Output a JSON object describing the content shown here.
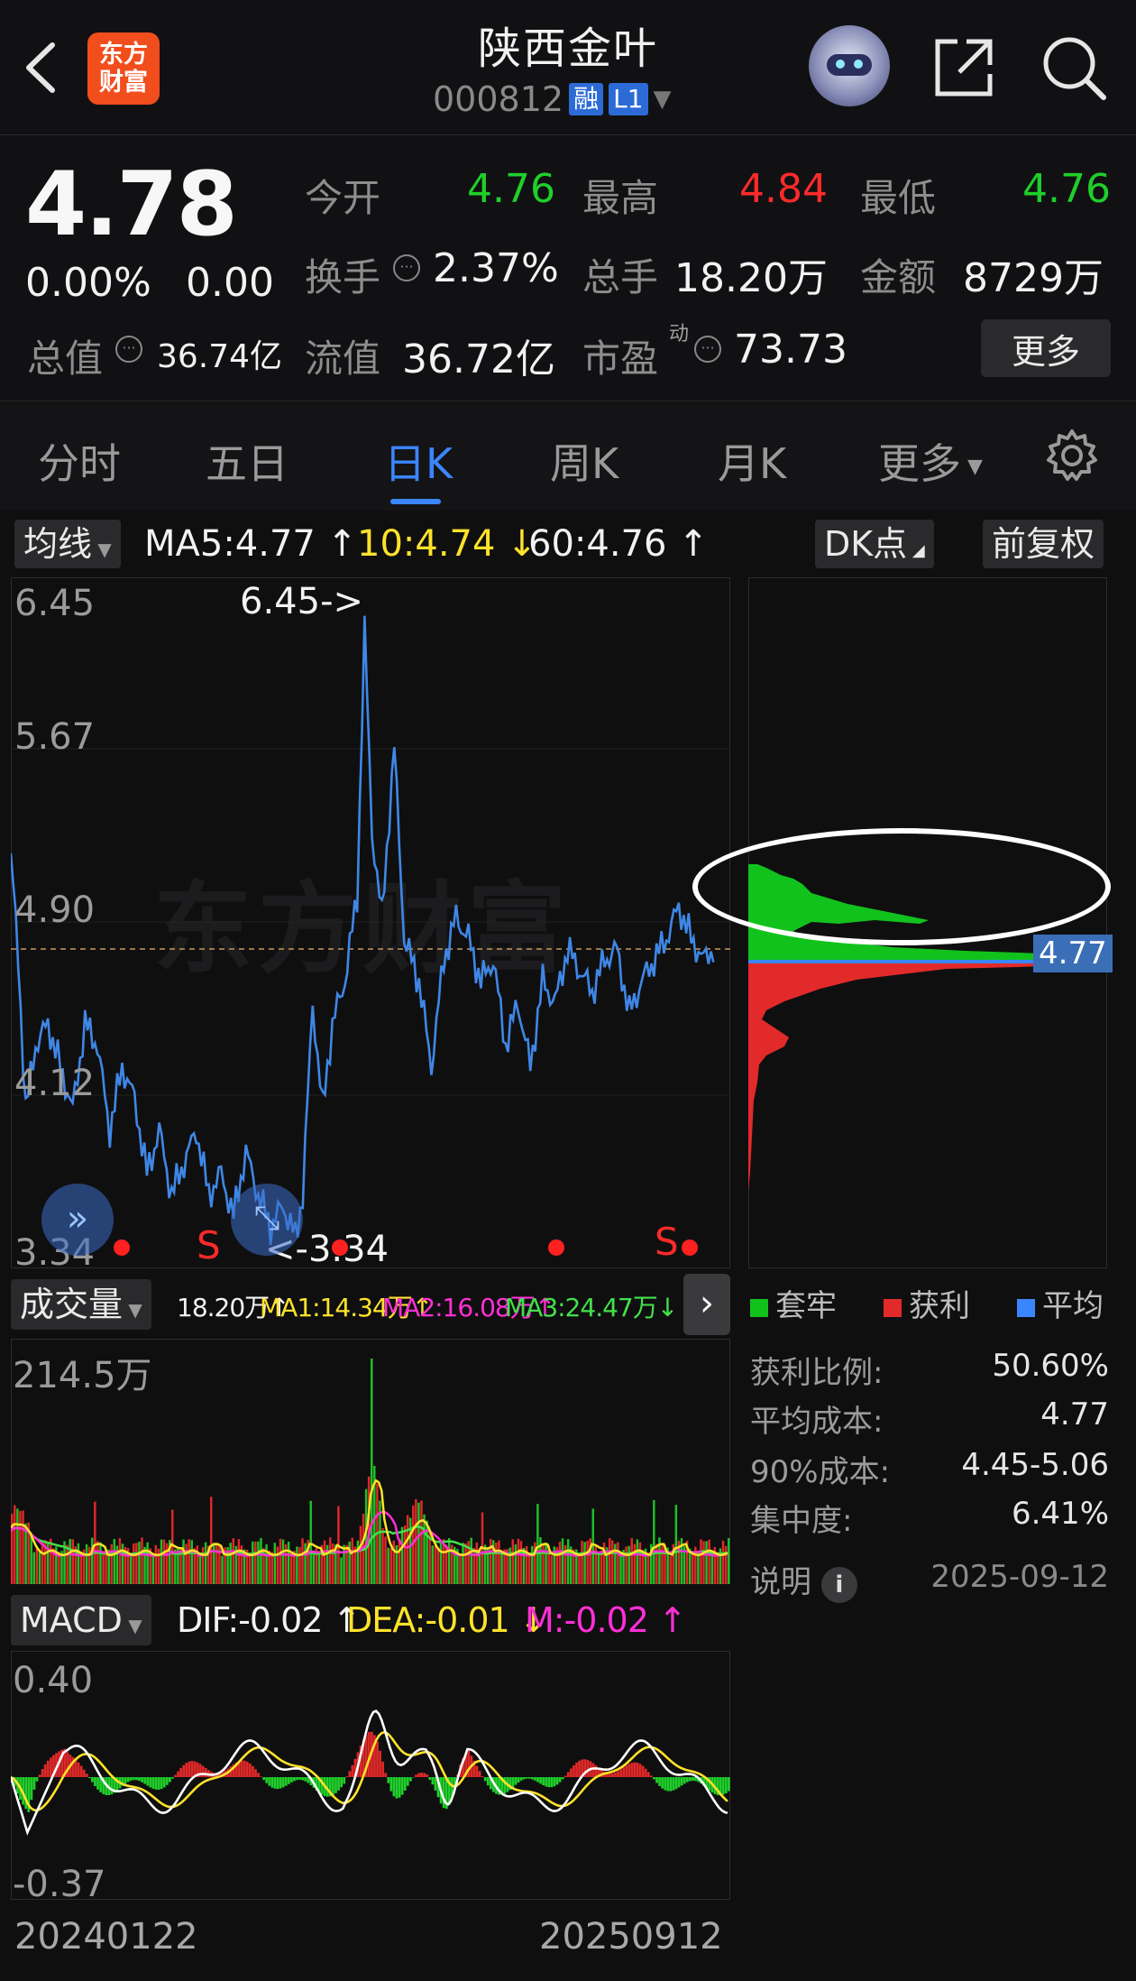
{
  "header": {
    "logo_line1": "东方",
    "logo_line2": "财富",
    "title": "陕西金叶",
    "code": "000812",
    "tag_margin": "融",
    "tag_level": "L1"
  },
  "quote": {
    "price": "4.78",
    "change_pct": "0.00%",
    "change": "0.00",
    "open_label": "今开",
    "open": "4.76",
    "high_label": "最高",
    "high": "4.84",
    "low_label": "最低",
    "low": "4.76",
    "turnover_label": "换手",
    "turnover": "2.37%",
    "volume_label": "总手",
    "volume": "18.20万",
    "amount_label": "金额",
    "amount": "8729万",
    "mktcap_label": "总值",
    "mktcap": "36.74亿",
    "float_label": "流值",
    "float": "36.72亿",
    "pe_label": "市盈",
    "pe_sup": "动",
    "pe": "73.73",
    "more_label": "更多"
  },
  "tabs": [
    "分时",
    "五日",
    "日K",
    "周K",
    "月K",
    "更多"
  ],
  "active_tab": "日K",
  "indicator": {
    "ma_chip": "均线",
    "ma5": "MA5:4.77 ↑",
    "ma10": "10:4.74 ↓",
    "ma60": "60:4.76 ↑",
    "dk_chip": "DK点",
    "adjust_chip": "前复权"
  },
  "kline": {
    "y_labels": [
      "6.45",
      "5.67",
      "4.90",
      "4.12",
      "3.34"
    ],
    "max_marker": "6.45->",
    "min_marker": "<-3.34",
    "sell_marker": "S",
    "current_price_tag": "4.77",
    "watermark": "东方财富"
  },
  "volume": {
    "chip": "成交量",
    "vol": "18.20万↑",
    "ma1": "MA1:14.34万↑",
    "ma2": "MA2:16.08万↑",
    "ma3": "MA3:24.47万↓",
    "y_max": "214.5万"
  },
  "macd": {
    "chip": "MACD",
    "dif": "DIF:-0.02 ↑",
    "dea": "DEA:-0.01 ↓",
    "m": "M:-0.02 ↑",
    "y_top": "0.40",
    "y_bottom": "-0.37",
    "date_start": "20240122",
    "date_end": "20250912"
  },
  "chip_dist": {
    "legend_trapped": "套牢",
    "legend_profit": "获利",
    "legend_avg": "平均",
    "profit_ratio_label": "获利比例:",
    "profit_ratio": "50.60%",
    "avg_cost_label": "平均成本:",
    "avg_cost": "4.77",
    "cost90_label": "90%成本:",
    "cost90": "4.45-5.06",
    "concentration_label": "集中度:",
    "concentration": "6.41%",
    "explain_label": "说明",
    "date": "2025-09-12"
  },
  "colors": {
    "up": "#ff2a2a",
    "down": "#1fcf2a",
    "accent": "#3a86ff",
    "ma1": "#ffe22a",
    "ma2": "#ff2fd6",
    "ma3": "#43e04a"
  }
}
